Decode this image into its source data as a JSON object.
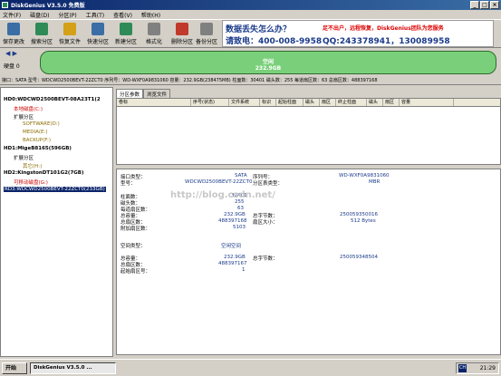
{
  "window": {
    "title": "DiskGenius V3.5.0 免费版"
  },
  "menu": [
    "文件(F)",
    "磁盘(D)",
    "分区(P)",
    "工具(T)",
    "查看(V)",
    "帮助(H)"
  ],
  "toolbar": [
    {
      "label": "保存更改",
      "color": "#3a6ea5"
    },
    {
      "label": "搜索分区",
      "color": "#2e8b57"
    },
    {
      "label": "恢复文件",
      "color": "#d4a017"
    },
    {
      "label": "快速分区",
      "color": "#3a6ea5"
    },
    {
      "label": "新建分区",
      "color": "#2e8b57"
    },
    {
      "label": "格式化",
      "color": "#808080"
    },
    {
      "label": "删除分区",
      "color": "#c0392b"
    },
    {
      "label": "备份分区",
      "color": "#808080"
    }
  ],
  "ad": {
    "line1": "数据丢失怎么办？",
    "line2": "请致电：400-008-9958",
    "right1": "足不出户，远程恢复，DiskGenius团队为您服务",
    "right2": "QQ:243378941，130089958"
  },
  "disk_map": {
    "label": "空闲",
    "size": "232.9GB",
    "disk_prefix": "硬盘 0"
  },
  "info_line": "接口：SATA  型号：WDCWD2500BEVT-22ZCT0  序列号：WD-WXF0A9831060  容量：232.9GB(238475MB)  柱面数：30401  磁头数：255  每道扇区数：63  总扇区数：488397168",
  "tree": [
    {
      "text": "HD0:WDCWD2500BEVT-08A23T1(2",
      "color": "#000",
      "bold": true
    },
    {
      "text": "本地磁盘(C:)",
      "color": "#c00"
    },
    {
      "text": "扩展分区",
      "color": "#000"
    },
    {
      "text": "SOFTWARE(D:)",
      "color": "#8a6d00"
    },
    {
      "text": "MEDIA(E:)",
      "color": "#8a6d00"
    },
    {
      "text": "BACKUP(F:)",
      "color": "#8a6d00"
    },
    {
      "text": "HD1:MigeB8165(596GB)",
      "color": "#000",
      "bold": true
    },
    {
      "text": "扩展分区",
      "color": "#000"
    },
    {
      "text": "其它(H:)",
      "color": "#8a6d00"
    },
    {
      "text": "HD2:KingstonDT101G2(7GB)",
      "color": "#000",
      "bold": true
    },
    {
      "text": "可移动磁盘(G:)",
      "color": "#c00"
    },
    {
      "text": "RD3:WDCWD2500BEVT-22ZCT0(233GB)",
      "color": "#000",
      "bold": true
    }
  ],
  "tabs": [
    "分区参数",
    "浏览文件"
  ],
  "columns": [
    "卷标",
    "序号(状态)",
    "文件系统",
    "标识",
    "起始柱面",
    "磁头",
    "扇区",
    "终止柱面",
    "磁头",
    "扇区",
    "容量"
  ],
  "details": {
    "interface_type_label": "接口类型：",
    "interface_type": "SATA",
    "model_label": "型号：",
    "model": "WDCWD2500BEVT-22ZCT0",
    "serial_label": "序列号：",
    "serial": "WD-WXF0A9831060",
    "table_type_label": "分区表类型：",
    "table_type": "MBR",
    "cylinders_label": "柱面数：",
    "cylinders": "30401",
    "heads_label": "磁头数：",
    "heads": "255",
    "spt_label": "每道扇区数：",
    "spt": "63",
    "capacity_label": "总容量：",
    "capacity": "232.9GB",
    "total_bytes_label": "总字节数：",
    "total_bytes": "250059350016",
    "total_sectors_label": "总扇区数：",
    "total_sectors": "488397168",
    "sector_size_label": "扇区大小：",
    "sector_size": "512 Bytes",
    "extra_sectors_label": "附加扇区数：",
    "extra_sectors": "5103",
    "space_type_label": "空间类型：",
    "space_type": "空闲空间",
    "free_cap_label": "总容量：",
    "free_cap": "232.9GB",
    "free_bytes_label": "总字节数：",
    "free_bytes": "250059348504",
    "free_sectors_label": "总扇区数：",
    "free_sectors": "488397167",
    "start_sector_label": "起始扇区号：",
    "start_sector": "1"
  },
  "watermark": "http://blog.csdn.net/",
  "taskbar": {
    "start": "开始",
    "task": "DiskGenius V3.5.0 ...",
    "lang": "CH",
    "time": "21:29"
  }
}
